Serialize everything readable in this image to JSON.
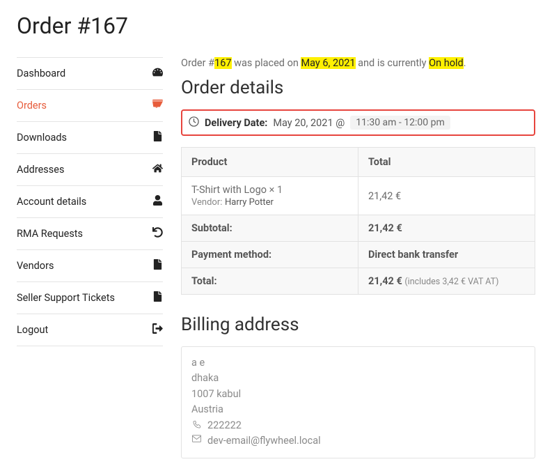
{
  "page_title": "Order #167",
  "sidebar": [
    {
      "label": "Dashboard",
      "icon": "dashboard-icon",
      "active": false
    },
    {
      "label": "Orders",
      "icon": "cart-icon",
      "active": true
    },
    {
      "label": "Downloads",
      "icon": "file-icon",
      "active": false
    },
    {
      "label": "Addresses",
      "icon": "home-icon",
      "active": false
    },
    {
      "label": "Account details",
      "icon": "user-icon",
      "active": false
    },
    {
      "label": "RMA Requests",
      "icon": "undo-icon",
      "active": false
    },
    {
      "label": "Vendors",
      "icon": "file-icon",
      "active": false
    },
    {
      "label": "Seller Support Tickets",
      "icon": "file-icon",
      "active": false
    },
    {
      "label": "Logout",
      "icon": "logout-icon",
      "active": false
    }
  ],
  "status_line": {
    "prefix": "Order #",
    "order_no": "167",
    "mid1": " was placed on ",
    "date": "May 6, 2021",
    "mid2": " and is currently ",
    "status": "On hold",
    "suffix": "."
  },
  "details_heading": "Order details",
  "delivery": {
    "label": "Delivery Date:",
    "date": "May 20, 2021 @",
    "time": "11:30 am - 12:00 pm"
  },
  "table": {
    "headers": [
      "Product",
      "Total"
    ],
    "item": {
      "product": "T-Shirt with Logo",
      "quantity": "× 1",
      "vendor_label": "Vendor:",
      "vendor": "Harry Potter",
      "total": "21,42 €"
    },
    "rows": [
      {
        "label": "Subtotal:",
        "value": "21,42 €"
      },
      {
        "label": "Payment method:",
        "value": "Direct bank transfer"
      },
      {
        "label": "Total:",
        "value": "21,42 €",
        "note": "(includes 3,42 € VAT AT)"
      }
    ]
  },
  "billing": {
    "heading": "Billing address",
    "name": "a e",
    "city": "dhaka",
    "postal": "1007 kabul",
    "country": "Austria",
    "phone": "222222",
    "email": "dev-email@flywheel.local"
  }
}
